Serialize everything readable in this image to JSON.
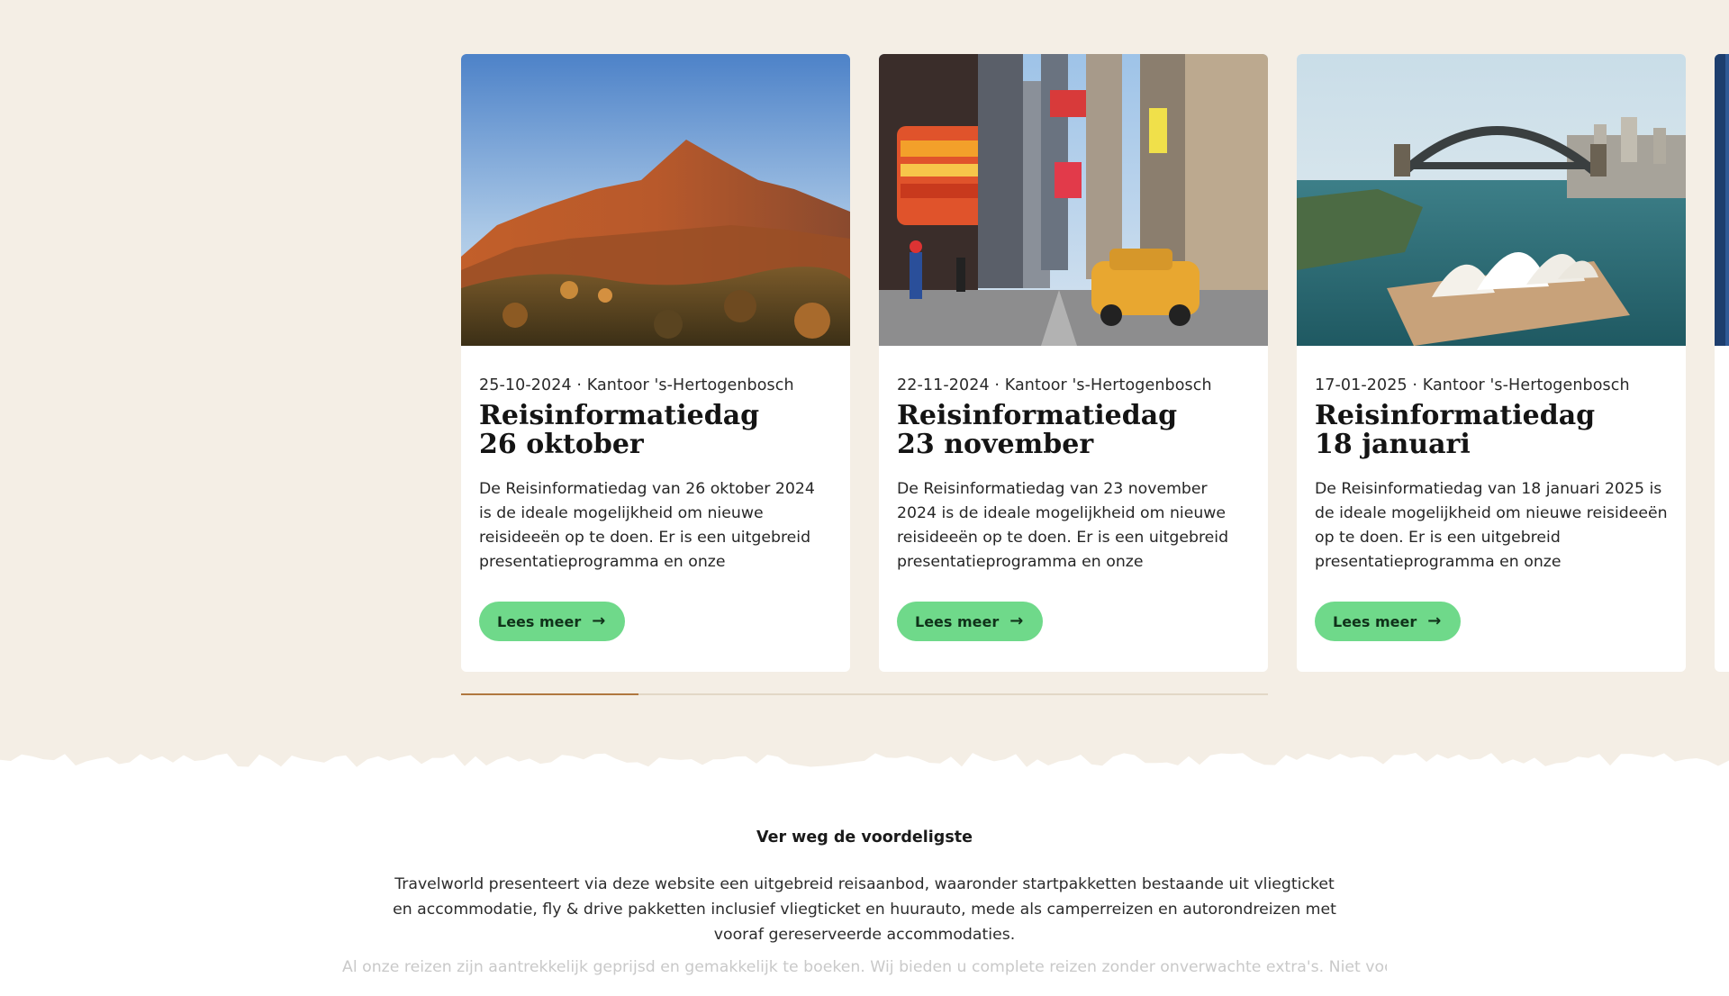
{
  "cards": [
    {
      "date": "25-10-2024",
      "location": "Kantoor 's-Hertogenbosch",
      "title": "Reisinformatiedag 26 oktober",
      "excerpt": "De Reisinformatiedag van 26 oktober 2024 is de ideale mogelijkheid om nieuwe reisideeën op te doen. Er is een uitgebreid presentatieprogramma en onze reisadviseurs…",
      "button": "Lees meer",
      "image": "table-mountain-photo"
    },
    {
      "date": "22-11-2024",
      "location": "Kantoor 's-Hertogenbosch",
      "title": "Reisinformatiedag 23 november",
      "excerpt": "De Reisinformatiedag van 23 november 2024 is de ideale mogelijkheid om nieuwe reisideeën op te doen. Er is een uitgebreid presentatieprogramma en onze reisadviseurs…",
      "button": "Lees meer",
      "image": "new-york-street-photo"
    },
    {
      "date": "17-01-2025",
      "location": "Kantoor 's-Hertogenbosch",
      "title": "Reisinformatiedag 18 januari",
      "excerpt": "De Reisinformatiedag van 18 januari 2025 is de ideale mogelijkheid om nieuwe reisideeën op te doen. Er is een uitgebreid presentatieprogramma en onze reisadviseurs…",
      "button": "Lees meer",
      "image": "sydney-harbour-photo"
    }
  ],
  "carousel": {
    "progress_fraction": 0.22
  },
  "intro": {
    "heading": "Ver weg de voordeligste",
    "paragraph": "Travelworld presenteert via deze website een uitgebreid reisaanbod, waaronder startpakketten bestaande uit vliegticket en accommodatie, fly & drive pakketten inclusief vliegticket en huurauto, mede als camperreizen en autorondreizen met vooraf gereserveerde accommodaties.",
    "paragraph_faded": "Al onze reizen zijn aantrekkelijk geprijsd en gemakkelijk te boeken. Wij bieden u complete reizen zonder onverwachte extra's. Niet voor"
  },
  "colors": {
    "background": "#f4eee5",
    "button": "#6fd98a",
    "progress_fill": "#b0773f"
  }
}
